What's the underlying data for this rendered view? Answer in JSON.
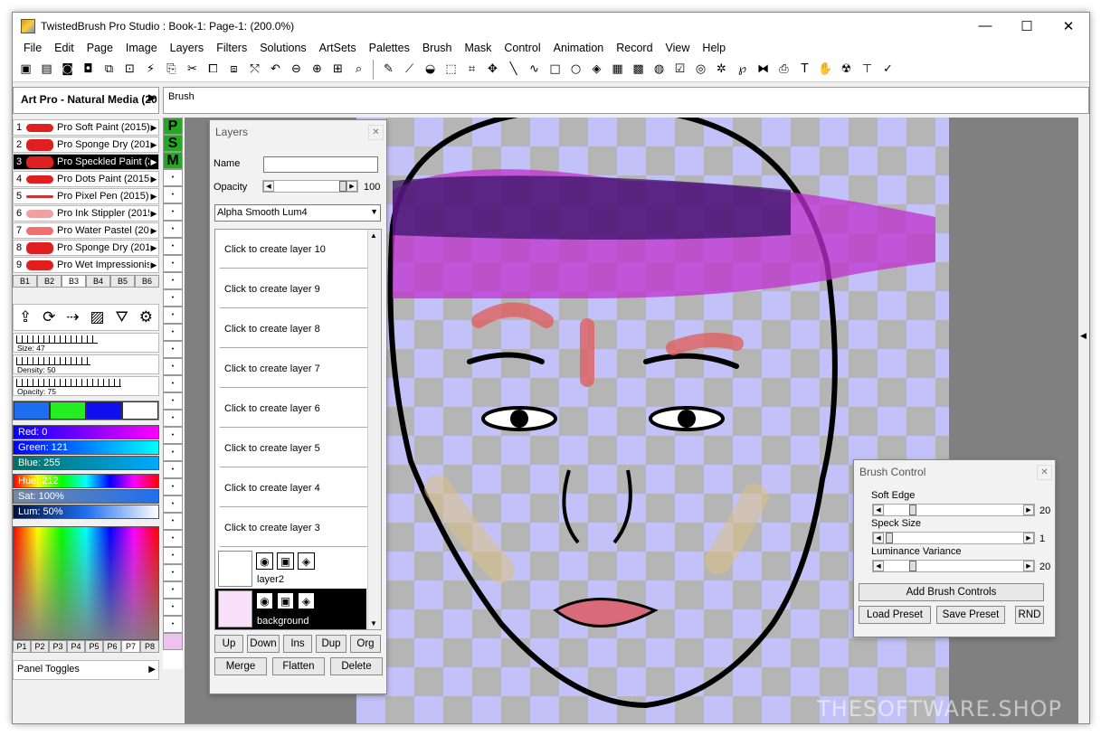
{
  "window": {
    "title": "TwistedBrush Pro Studio : Book-1: Page-1:  (200.0%)",
    "minimize": "—",
    "maximize": "☐",
    "close": "✕"
  },
  "menu": [
    "File",
    "Edit",
    "Page",
    "Image",
    "Layers",
    "Filters",
    "Solutions",
    "ArtSets",
    "Palettes",
    "Brush",
    "Mask",
    "Control",
    "Animation",
    "Record",
    "View",
    "Help"
  ],
  "toolbar_icons": [
    "save-icon",
    "book-icon",
    "page-icon",
    "page-add-icon",
    "page-copy-icon",
    "page-export-icon",
    "brush-wand-icon",
    "copy-icon",
    "cut-icon",
    "paste-icon",
    "paste-special-icon",
    "clone-icon",
    "undo-icon",
    "zoom-out-icon",
    "zoom-in-icon",
    "zoom-fit-icon",
    "zoom-icon",
    "pencil-icon",
    "pipette-icon",
    "bucket-icon",
    "select-rect-icon",
    "crop-icon",
    "move-icon",
    "line-icon",
    "freehand-icon",
    "rectangle-icon",
    "ellipse-icon",
    "fill-icon",
    "pattern-icon",
    "checker-icon",
    "grid-icon",
    "check-icon",
    "magic-icon",
    "sparkle-icon",
    "spiral-icon",
    "shapes-icon",
    "copy2-icon",
    "text-icon",
    "hand-icon",
    "smudge-icon",
    "stamp-icon",
    "wand-icon"
  ],
  "artset": {
    "label": "Art Pro - Natural Media (20",
    "arrow": "▶"
  },
  "brush_bar": {
    "label": "Brush"
  },
  "brushes": [
    {
      "num": "1",
      "name": "Pro Soft Paint (2015)"
    },
    {
      "num": "2",
      "name": "Pro Sponge Dry (201"
    },
    {
      "num": "3",
      "name": "Pro Speckled Paint (2"
    },
    {
      "num": "4",
      "name": "Pro Dots Paint (2015"
    },
    {
      "num": "5",
      "name": "Pro Pixel Pen (2015)"
    },
    {
      "num": "6",
      "name": "Pro Ink Stippler (2015"
    },
    {
      "num": "7",
      "name": "Pro Water Pastel (20"
    },
    {
      "num": "8",
      "name": "Pro Sponge Dry (201"
    },
    {
      "num": "9",
      "name": "Pro Wet Impressionis"
    }
  ],
  "brush_tabs": [
    "B1",
    "B2",
    "B3",
    "B4",
    "B5",
    "B6"
  ],
  "sliders": {
    "size": "Size: 47",
    "density": "Density: 50",
    "opacity": "Opacity: 75"
  },
  "colors": {
    "swatches": [
      "#1e6ff0",
      "#22ee22",
      "#1010ee",
      "#ffffff"
    ]
  },
  "color_bars": {
    "red": "Red: 0",
    "green": "Green: 121",
    "blue": "Blue: 255",
    "hue": "Hue: 212",
    "sat": "Sat: 100%",
    "lum": "Lum: 50%"
  },
  "palette_tabs": [
    "P1",
    "P2",
    "P3",
    "P4",
    "P5",
    "P6",
    "P7",
    "P8"
  ],
  "panel_toggles": "Panel Toggles",
  "psm": [
    "P",
    "S",
    "M"
  ],
  "layers_panel": {
    "title": "Layers",
    "name_label": "Name",
    "opacity_label": "Opacity",
    "opacity_value": "100",
    "blend_mode": "Alpha Smooth Lum4",
    "placeholders": [
      "Click to create layer 10",
      "Click to create layer 9",
      "Click to create layer 8",
      "Click to create layer 7",
      "Click to create layer 6",
      "Click to create layer 5",
      "Click to create layer 4",
      "Click to create layer 3"
    ],
    "layers": [
      "layer2",
      "background"
    ],
    "buttons_row1": [
      "Up",
      "Down",
      "Ins",
      "Dup",
      "Org"
    ],
    "buttons_row2": [
      "Merge",
      "Flatten",
      "Delete"
    ]
  },
  "brush_control": {
    "title": "Brush Control",
    "soft_edge": {
      "label": "Soft Edge",
      "value": "20"
    },
    "speck_size": {
      "label": "Speck Size",
      "value": "1"
    },
    "lum_var": {
      "label": "Luminance Variance",
      "value": "20"
    },
    "add_controls": "Add Brush Controls",
    "load_preset": "Load Preset",
    "save_preset": "Save Preset",
    "rnd": "RND"
  },
  "watermark": "THESOFTWARE.SHOP"
}
